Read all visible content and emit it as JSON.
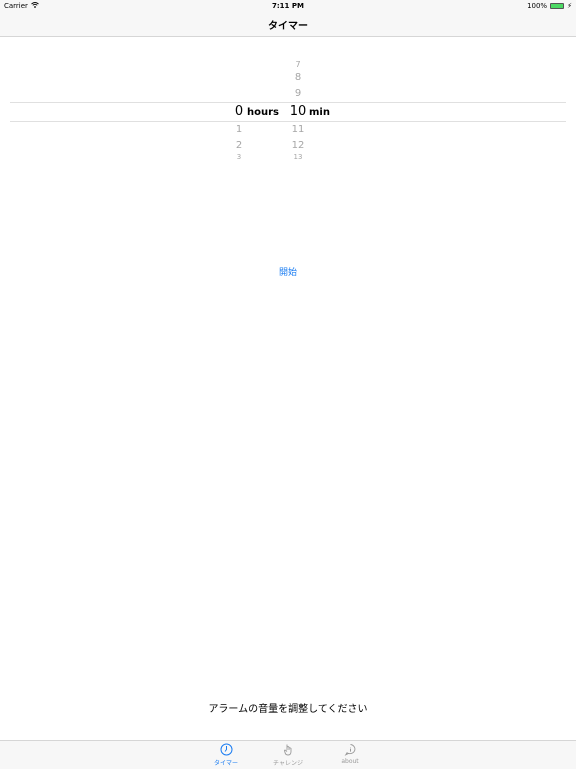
{
  "statusbar": {
    "carrier": "Carrier",
    "time": "7:11 PM",
    "battery_text": "100%",
    "battery_level": 1.0
  },
  "navbar": {
    "title": "タイマー"
  },
  "picker": {
    "hours": {
      "above": [
        "",
        "",
        ""
      ],
      "selected": "0",
      "below": [
        "1",
        "2",
        "3"
      ],
      "unit": "hours"
    },
    "minutes": {
      "above": [
        "7",
        "8",
        "9"
      ],
      "selected": "10",
      "below": [
        "11",
        "12",
        "13"
      ],
      "unit": "min"
    }
  },
  "start_button": {
    "label": "開始"
  },
  "volume_message": "アラームの音量を調整してください",
  "tabbar": {
    "items": [
      {
        "label": "タイマー",
        "icon": "clock-icon",
        "active": true
      },
      {
        "label": "チャレンジ",
        "icon": "hand-icon",
        "active": false
      },
      {
        "label": "about",
        "icon": "info-bubble-icon",
        "active": false
      }
    ]
  },
  "colors": {
    "accent": "#1a7cf2",
    "battery": "#4cd964",
    "inactive": "#999999"
  }
}
